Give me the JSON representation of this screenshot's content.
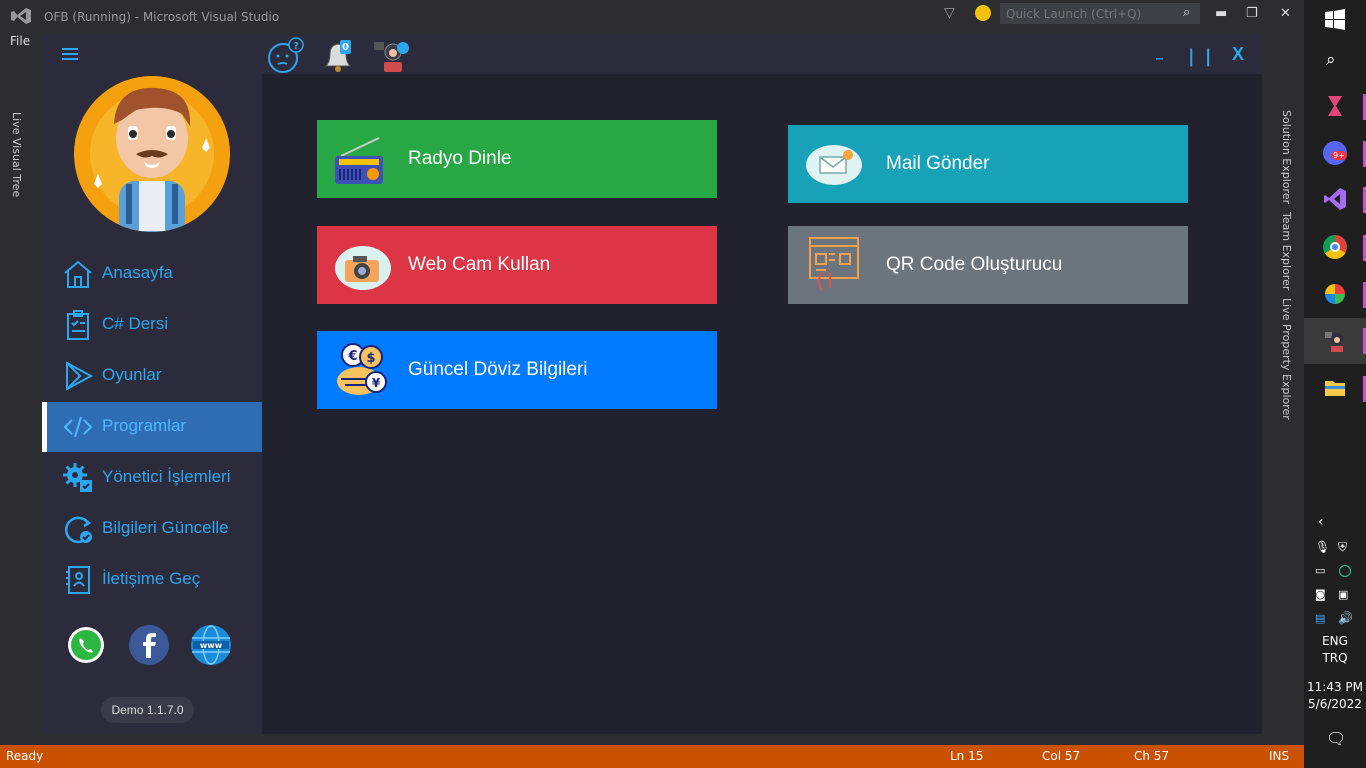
{
  "vs": {
    "title": "OFB (Running) - Microsoft Visual Studio",
    "quick_launch_placeholder": "Quick Launch (Ctrl+Q)",
    "menu_file": "File",
    "left_tab": "Live Visual Tree",
    "right_tabs": [
      "Solution Explorer",
      "Team Explorer",
      "Live Property Explorer"
    ],
    "status": {
      "ready": "Ready",
      "ln": "Ln 15",
      "col": "Col 57",
      "ch": "Ch 57",
      "ins": "INS"
    }
  },
  "taskbar": {
    "lang_line1": "ENG",
    "lang_line2": "TRQ",
    "time": "11:43 PM",
    "date": "5/6/2022",
    "discord_badge": "9+"
  },
  "app": {
    "notification_count": "0",
    "nav": [
      {
        "label": "Anasayfa",
        "icon": "home-icon"
      },
      {
        "label": "C# Dersi",
        "icon": "clipboard-icon"
      },
      {
        "label": "Oyunlar",
        "icon": "play-icon"
      },
      {
        "label": "Programlar",
        "icon": "code-icon",
        "active": true
      },
      {
        "label": "Yönetici İşlemleri",
        "icon": "gear-icon"
      },
      {
        "label": "Bilgileri Güncelle",
        "icon": "refresh-check-icon"
      },
      {
        "label": "İletişime Geç",
        "icon": "contact-icon"
      }
    ],
    "version": "Demo 1.1.7.0",
    "window_controls": {
      "minimize": "_",
      "pause": "| |",
      "close": "X"
    },
    "tiles": [
      {
        "label": "Radyo Dinle",
        "color": "#28a745",
        "icon": "radio-icon"
      },
      {
        "label": "Web Cam Kullan",
        "color": "#dc3545",
        "icon": "camera-icon"
      },
      {
        "label": "Güncel Döviz Bilgileri",
        "color": "#007bff",
        "icon": "currency-icon"
      },
      {
        "label": "Mail Gönder",
        "color": "#17a2b8",
        "icon": "mail-icon"
      },
      {
        "label": "QR Code Oluşturucu",
        "color": "#6c757d",
        "icon": "qr-code-icon"
      }
    ]
  },
  "colors": {
    "accent": "#2aa7f0",
    "sidebar": "#2c2b3b",
    "content": "#22222e",
    "active_nav": "#2e6db4",
    "statusbar": "#ca5100"
  }
}
